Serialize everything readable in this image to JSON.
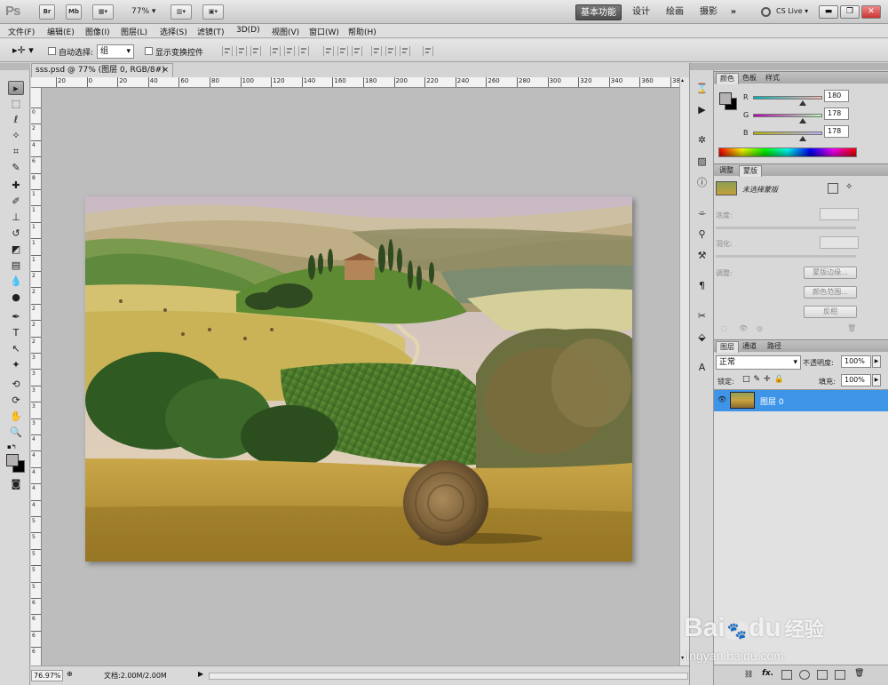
{
  "app": {
    "logo": "Ps",
    "bridge_label": "Br",
    "minibridge_label": "Mb",
    "zoom": "77%",
    "workspaces": [
      "基本功能",
      "设计",
      "绘画",
      "摄影"
    ],
    "more_label": "»",
    "cslive": "CS Live"
  },
  "menu": [
    "文件(F)",
    "编辑(E)",
    "图像(I)",
    "图层(L)",
    "选择(S)",
    "滤镜(T)",
    "3D(D)",
    "视图(V)",
    "窗口(W)",
    "帮助(H)"
  ],
  "options": {
    "auto_select_label": "自动选择:",
    "auto_select_value": "组",
    "show_transform_label": "显示变换控件"
  },
  "document": {
    "tab_title": "sss.psd @ 77% (图层 0, RGB/8#)",
    "tab_close": "×",
    "ruler_top_labels": [
      "20",
      "0",
      "20",
      "40",
      "60",
      "80",
      "100",
      "120",
      "140",
      "160",
      "180",
      "200",
      "220",
      "240",
      "260",
      "280",
      "300",
      "320",
      "340",
      "360",
      "380"
    ],
    "ruler_left_labels": [
      "0",
      "2",
      "4",
      "6",
      "8",
      "1",
      "1",
      "1",
      "1",
      "1",
      "2",
      "2",
      "2",
      "2",
      "2",
      "3",
      "3",
      "3",
      "3",
      "3",
      "4",
      "4",
      "4",
      "4",
      "4",
      "5",
      "5",
      "5",
      "5",
      "5",
      "6",
      "6",
      "6",
      "6"
    ],
    "status_zoom": "76.97%",
    "status_doc": "文档:2.00M/2.00M"
  },
  "color_panel": {
    "tabs": [
      "颜色",
      "色板",
      "样式"
    ],
    "r_label": "R",
    "g_label": "G",
    "b_label": "B",
    "r": "180",
    "g": "178",
    "b": "178",
    "r_fraction": 0.706,
    "g_fraction": 0.698,
    "b_fraction": 0.698
  },
  "masks_panel": {
    "tabs": [
      "调整",
      "蒙版"
    ],
    "no_mask": "未选择蒙版",
    "density_label": "浓度:",
    "feather_label": "羽化:",
    "refine_label": "调整:",
    "btn_edge": "蒙版边缘...",
    "btn_range": "颜色范围...",
    "btn_invert": "反相"
  },
  "layers_panel": {
    "tabs": [
      "图层",
      "通道",
      "路径"
    ],
    "blend_mode": "正常",
    "opacity_label": "不透明度:",
    "opacity": "100%",
    "lock_label": "锁定:",
    "fill_label": "填充:",
    "fill": "100%",
    "layer_name": "图层 0",
    "fx_label": "fx."
  },
  "watermark": {
    "text": "Bai",
    "du": "du",
    "cn": "经验",
    "url": "jingyan.baidu.com"
  },
  "colors": {
    "accent": "#3e95e8",
    "canvas_bg": "#bdbdbd"
  }
}
